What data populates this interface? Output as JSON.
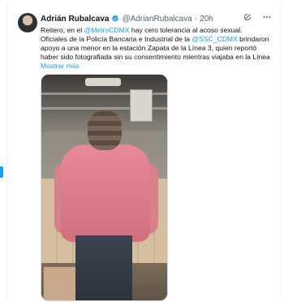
{
  "tweet": {
    "author_name": "Adrián Rubalcava",
    "author_handle": "@AdrianRubalcava",
    "separator": "·",
    "time": "20h",
    "text_parts": [
      {
        "t": "Reitero, en el ",
        "mention": false
      },
      {
        "t": "@MetroCDMX",
        "mention": true
      },
      {
        "t": " hay cero tolerancia al acoso sexual.",
        "mention": false
      },
      {
        "t": "\nOficiales de la Policía Bancaria e Industrial de la ",
        "mention": false
      },
      {
        "t": "@SSC_CDMX",
        "mention": true
      },
      {
        "t": " brindaron apoyo a una menor en la estación Zapata de la Línea 3, quien reportó haber sido  fotografiada sin su consentimiento mientras viajaba en la Línea",
        "mention": false
      }
    ],
    "show_more": "Mostrar más"
  },
  "icons": {
    "verified": "verified-badge-icon",
    "grok": "grok-icon",
    "more": "more-options-icon"
  },
  "colors": {
    "accent": "#1d9bf0",
    "text": "#0f1419",
    "muted": "#536471"
  }
}
